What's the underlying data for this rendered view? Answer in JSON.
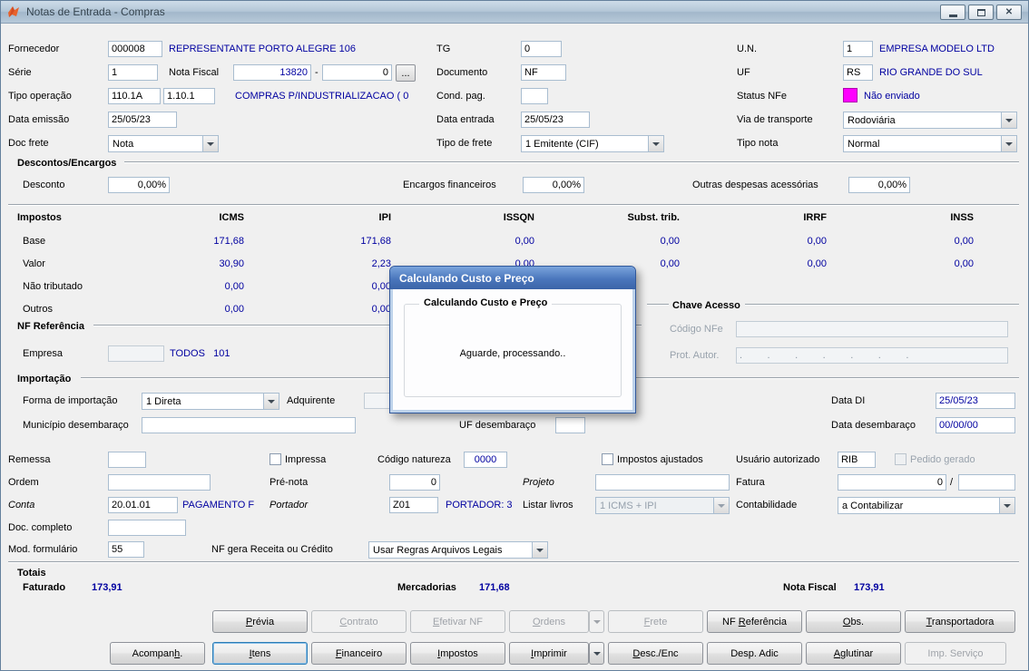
{
  "window": {
    "title": "Notas de Entrada - Compras"
  },
  "icons": {
    "close": "✕"
  },
  "top": {
    "fornecedor": {
      "label": "Fornecedor",
      "code": "000008",
      "desc": "REPRESENTANTE PORTO ALEGRE 106"
    },
    "tg": {
      "label": "TG",
      "value": "0"
    },
    "un": {
      "label": "U.N.",
      "code": "1",
      "desc": "EMPRESA MODELO LTD"
    },
    "serie": {
      "label": "Série",
      "value": "1"
    },
    "nota_fiscal": {
      "label": "Nota Fiscal",
      "numero": "13820",
      "sep": "-",
      "sufixo": "0",
      "browse": "..."
    },
    "documento": {
      "label": "Documento",
      "value": "NF"
    },
    "uf": {
      "label": "UF",
      "code": "RS",
      "desc": "RIO GRANDE DO SUL"
    },
    "tipo_operacao": {
      "label": "Tipo operação",
      "code1": "110.1A",
      "code2": "1.10.1",
      "desc": "COMPRAS P/INDUSTRIALIZACAO ( 0"
    },
    "cond_pag": {
      "label": "Cond. pag.",
      "value": ""
    },
    "status_nfe": {
      "label": "Status NFe",
      "value": "Não enviado",
      "color": "#FF00FF"
    },
    "data_emissao": {
      "label": "Data emissão",
      "value": "25/05/23"
    },
    "data_entrada": {
      "label": "Data entrada",
      "value": "25/05/23"
    },
    "via_transporte": {
      "label": "Via de transporte",
      "value": "Rodoviária"
    },
    "doc_frete": {
      "label": "Doc frete",
      "value": "Nota"
    },
    "tipo_frete": {
      "label": "Tipo de frete",
      "value": "1 Emitente (CIF)"
    },
    "tipo_nota": {
      "label": "Tipo nota",
      "value": "Normal"
    }
  },
  "descontos": {
    "title": "Descontos/Encargos",
    "desconto": {
      "label": "Desconto",
      "value": "0,00%"
    },
    "encargos": {
      "label": "Encargos financeiros",
      "value": "0,00%"
    },
    "outras": {
      "label": "Outras despesas acessórias",
      "value": "0,00%"
    }
  },
  "impostos": {
    "title": "Impostos",
    "headers": [
      "ICMS",
      "IPI",
      "ISSQN",
      "Subst. trib.",
      "IRRF",
      "INSS"
    ],
    "rows": [
      {
        "label": "Base",
        "values": [
          "171,68",
          "171,68",
          "0,00",
          "0,00",
          "0,00",
          "0,00"
        ]
      },
      {
        "label": "Valor",
        "values": [
          "30,90",
          "2,23",
          "0,00",
          "0,00",
          "0,00",
          "0,00"
        ]
      },
      {
        "label": "Não tributado",
        "values": [
          "0,00",
          "0,00",
          "",
          "",
          "",
          ""
        ]
      },
      {
        "label": "Outros",
        "values": [
          "0,00",
          "0,00",
          "",
          "",
          "",
          ""
        ]
      }
    ]
  },
  "nf_referencia": {
    "title": "NF Referência",
    "empresa": {
      "label": "Empresa",
      "value": "",
      "desc": "TODOS   101"
    }
  },
  "chave_acesso": {
    "title": "Chave Acesso",
    "codigo_nfe": {
      "label": "Código NFe",
      "value": ""
    },
    "prot_autor": {
      "label": "Prot. Autor.",
      "value": ".         .         .         .         .         .         ."
    }
  },
  "importacao": {
    "title": "Importação",
    "forma": {
      "label": "Forma de importação",
      "value": "1 Direta"
    },
    "adquirente": {
      "label": "Adquirente",
      "value": ""
    },
    "data_di": {
      "label": "Data DI",
      "value": "25/05/23"
    },
    "municipio": {
      "label": "Município desembaraço",
      "value": ""
    },
    "uf_desembaraco": {
      "label": "UF desembaraço",
      "value": ""
    },
    "data_desembaraco": {
      "label": "Data desembaraço",
      "value": "00/00/00"
    }
  },
  "campos": {
    "remessa": {
      "label": "Remessa",
      "value": ""
    },
    "impressa": {
      "label": "Impressa",
      "checked": false
    },
    "codigo_natureza": {
      "label": "Código natureza",
      "value": "0000"
    },
    "impostos_ajustados": {
      "label": "Impostos ajustados",
      "checked": false
    },
    "usuario_autorizado": {
      "label": "Usuário autorizado",
      "value": "RIB"
    },
    "pedido_gerado": {
      "label": "Pedido gerado",
      "checked": false
    },
    "ordem": {
      "label": "Ordem",
      "value": ""
    },
    "pre_nota": {
      "label": "Pré-nota",
      "value": "0"
    },
    "projeto": {
      "label": "Projeto",
      "value": ""
    },
    "fatura": {
      "label": "Fatura",
      "value": "0",
      "sep": "/",
      "value2": ""
    },
    "conta": {
      "label": "Conta",
      "value": "20.01.01",
      "desc": "PAGAMENTO F"
    },
    "portador": {
      "label": "Portador",
      "value": "Z01",
      "desc": "PORTADOR: 3"
    },
    "listar_livros": {
      "label": "Listar livros",
      "value": "1 ICMS + IPI"
    },
    "contabilidade": {
      "label": "Contabilidade",
      "value": "a Contabilizar"
    },
    "doc_completo": {
      "label": "Doc. completo",
      "value": ""
    },
    "mod_formulario": {
      "label": "Mod. formulário",
      "value": "55"
    },
    "nf_gera": {
      "label": "NF gera Receita ou Crédito",
      "value": "Usar Regras Arquivos Legais"
    }
  },
  "totais": {
    "title": "Totais",
    "faturado": {
      "label": "Faturado",
      "value": "173,91"
    },
    "mercadorias": {
      "label": "Mercadorias",
      "value": "171,68"
    },
    "nota_fiscal": {
      "label": "Nota Fiscal",
      "value": "173,91"
    }
  },
  "buttons": {
    "row1": [
      {
        "label": "Prévia",
        "disabled": false
      },
      {
        "label": "Contrato",
        "disabled": true
      },
      {
        "label": "Efetivar NF",
        "disabled": true
      },
      {
        "label": "Ordens",
        "disabled": true,
        "split": true
      },
      {
        "label": "Frete",
        "disabled": true
      },
      {
        "label": "NF Referência",
        "disabled": false
      },
      {
        "label": "Obs.",
        "disabled": false
      },
      {
        "label": "Transportadora",
        "disabled": false
      }
    ],
    "row2": [
      {
        "label": "Acompanh.",
        "disabled": false
      },
      {
        "label": "Itens",
        "disabled": false,
        "focused": true
      },
      {
        "label": "Financeiro",
        "disabled": false
      },
      {
        "label": "Impostos",
        "disabled": false
      },
      {
        "label": "Imprimir",
        "disabled": false,
        "split": true
      },
      {
        "label": "Desc./Enc",
        "disabled": false
      },
      {
        "label": "Desp. Adic",
        "disabled": false
      },
      {
        "label": "Aglutinar",
        "disabled": false
      },
      {
        "label": "Imp. Serviço",
        "disabled": true
      }
    ]
  },
  "dialog": {
    "title": "Calculando Custo e Preço",
    "group_title": "Calculando Custo e Preço",
    "message": "Aguarde, processando.."
  }
}
